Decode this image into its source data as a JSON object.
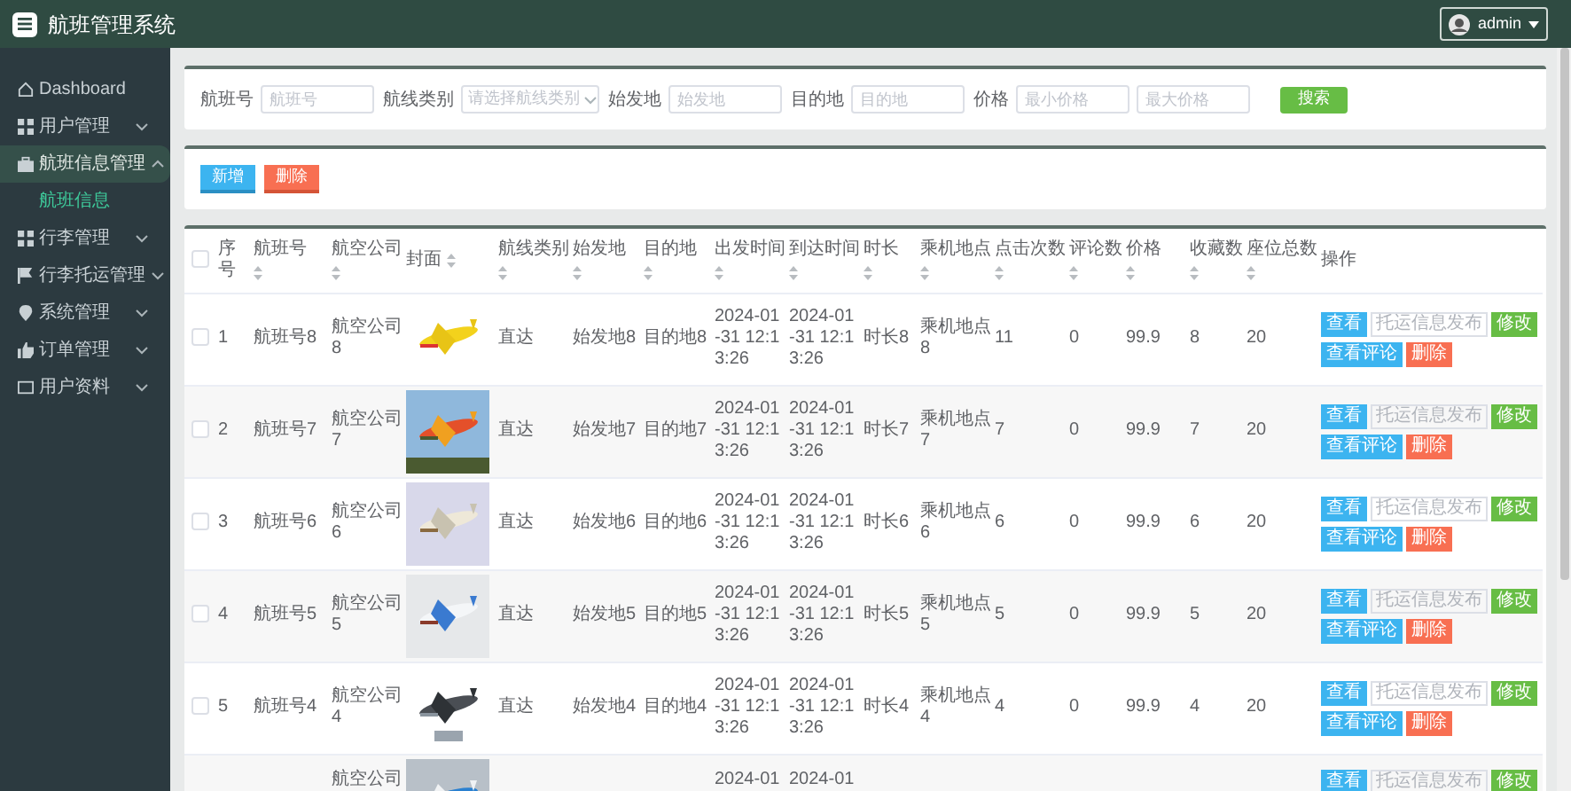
{
  "header": {
    "title": "航班管理系统",
    "user": "admin"
  },
  "sidebar": {
    "items": [
      {
        "label": "Dashboard",
        "kind": "link",
        "selected": false
      },
      {
        "label": "用户管理",
        "kind": "group",
        "expanded": false,
        "selected": false
      },
      {
        "label": "航班信息管理",
        "kind": "group",
        "expanded": true,
        "selected": true,
        "children": [
          {
            "label": "航班信息",
            "selected": true
          }
        ]
      },
      {
        "label": "行李管理",
        "kind": "group",
        "expanded": false,
        "selected": false
      },
      {
        "label": "行李托运管理",
        "kind": "group",
        "expanded": false,
        "selected": false
      },
      {
        "label": "系统管理",
        "kind": "group",
        "expanded": false,
        "selected": false
      },
      {
        "label": "订单管理",
        "kind": "group",
        "expanded": false,
        "selected": false
      },
      {
        "label": "用户资料",
        "kind": "group",
        "expanded": false,
        "selected": false
      }
    ]
  },
  "filters": [
    {
      "label": "航班号",
      "kind": "text",
      "placeholder": "航班号"
    },
    {
      "label": "航线类别",
      "kind": "select",
      "placeholder": "请选择航线类别"
    },
    {
      "label": "始发地",
      "kind": "text",
      "placeholder": "始发地"
    },
    {
      "label": "目的地",
      "kind": "text",
      "placeholder": "目的地"
    },
    {
      "label": "价格",
      "kind": "range",
      "placeholders": [
        "最小价格",
        "最大价格"
      ]
    }
  ],
  "search_button": "搜索",
  "toolbar": [
    {
      "label": "新增",
      "kind": "primary"
    },
    {
      "label": "删除",
      "kind": "danger"
    }
  ],
  "table": {
    "select_all": false,
    "columns": [
      {
        "label": "序号",
        "sortable": false
      },
      {
        "label": "航班号",
        "sortable": true
      },
      {
        "label": "航空公司",
        "sortable": true
      },
      {
        "label": "封面",
        "sortable": true,
        "kind": "picture"
      },
      {
        "label": "航线类别",
        "sortable": true
      },
      {
        "label": "始发地",
        "sortable": true
      },
      {
        "label": "目的地",
        "sortable": true
      },
      {
        "label": "出发时间",
        "sortable": true
      },
      {
        "label": "到达时间",
        "sortable": true
      },
      {
        "label": "时长",
        "sortable": true
      },
      {
        "label": "乘机地点",
        "sortable": true
      },
      {
        "label": "点击次数",
        "sortable": true
      },
      {
        "label": "评论数",
        "sortable": true
      },
      {
        "label": "价格",
        "sortable": true
      },
      {
        "label": "收藏数",
        "sortable": true
      },
      {
        "label": "座位总数",
        "sortable": true
      },
      {
        "label": "操作",
        "sortable": false,
        "kind": "actions"
      }
    ],
    "rows": [
      {
        "checked": false,
        "cells": [
          "1",
          "航班号8",
          "航空公司8",
          null,
          "直达",
          "始发地8",
          "目的地8",
          "2024-01-31 12:13:26",
          "2024-01-31 12:13:26",
          "时长8",
          "乘机地点8",
          "11",
          "0",
          "99.9",
          "8",
          "20",
          null
        ],
        "actions": [
          {
            "kind": "view",
            "label": "查看"
          },
          {
            "kind": "field",
            "placeholder": "托运信息发布"
          },
          {
            "kind": "edit",
            "label": "修改"
          },
          {
            "kind": "comments",
            "label": "查看评论"
          },
          {
            "kind": "delete",
            "label": "删除"
          }
        ]
      },
      {
        "checked": false,
        "cells": [
          "2",
          "航班号7",
          "航空公司7",
          null,
          "直达",
          "始发地7",
          "目的地7",
          "2024-01-31 12:13:26",
          "2024-01-31 12:13:26",
          "时长7",
          "乘机地点7",
          "7",
          "0",
          "99.9",
          "7",
          "20",
          null
        ],
        "actions": [
          {
            "kind": "view",
            "label": "查看"
          },
          {
            "kind": "field",
            "placeholder": "托运信息发布"
          },
          {
            "kind": "edit",
            "label": "修改"
          },
          {
            "kind": "comments",
            "label": "查看评论"
          },
          {
            "kind": "delete",
            "label": "删除"
          }
        ]
      },
      {
        "checked": false,
        "cells": [
          "3",
          "航班号6",
          "航空公司6",
          null,
          "直达",
          "始发地6",
          "目的地6",
          "2024-01-31 12:13:26",
          "2024-01-31 12:13:26",
          "时长6",
          "乘机地点6",
          "6",
          "0",
          "99.9",
          "6",
          "20",
          null
        ],
        "actions": [
          {
            "kind": "view",
            "label": "查看"
          },
          {
            "kind": "field",
            "placeholder": "托运信息发布"
          },
          {
            "kind": "edit",
            "label": "修改"
          },
          {
            "kind": "comments",
            "label": "查看评论"
          },
          {
            "kind": "delete",
            "label": "删除"
          }
        ]
      },
      {
        "checked": false,
        "cells": [
          "4",
          "航班号5",
          "航空公司5",
          null,
          "直达",
          "始发地5",
          "目的地5",
          "2024-01-31 12:13:26",
          "2024-01-31 12:13:26",
          "时长5",
          "乘机地点5",
          "5",
          "0",
          "99.9",
          "5",
          "20",
          null
        ],
        "actions": [
          {
            "kind": "view",
            "label": "查看"
          },
          {
            "kind": "field",
            "placeholder": "托运信息发布"
          },
          {
            "kind": "edit",
            "label": "修改"
          },
          {
            "kind": "comments",
            "label": "查看评论"
          },
          {
            "kind": "delete",
            "label": "删除"
          }
        ]
      },
      {
        "checked": false,
        "cells": [
          "5",
          "航班号4",
          "航空公司4",
          null,
          "直达",
          "始发地4",
          "目的地4",
          "2024-01-31 12:13:26",
          "2024-01-31 12:13:26",
          "时长4",
          "乘机地点4",
          "4",
          "0",
          "99.9",
          "4",
          "20",
          null
        ],
        "actions": [
          {
            "kind": "view",
            "label": "查看"
          },
          {
            "kind": "field",
            "placeholder": "托运信息发布"
          },
          {
            "kind": "edit",
            "label": "修改"
          },
          {
            "kind": "comments",
            "label": "查看评论"
          },
          {
            "kind": "delete",
            "label": "删除"
          }
        ]
      },
      {
        "cells": [
          null,
          null,
          "航空公司",
          null,
          null,
          null,
          null,
          "2024-01",
          "2024-01",
          null,
          null,
          null,
          null,
          null,
          null,
          null,
          null
        ],
        "actions": [
          {
            "kind": "view",
            "label": "查看"
          },
          {
            "kind": "field",
            "placeholder": "托运信息发布"
          },
          {
            "kind": "edit",
            "label": "修改"
          }
        ]
      }
    ]
  }
}
